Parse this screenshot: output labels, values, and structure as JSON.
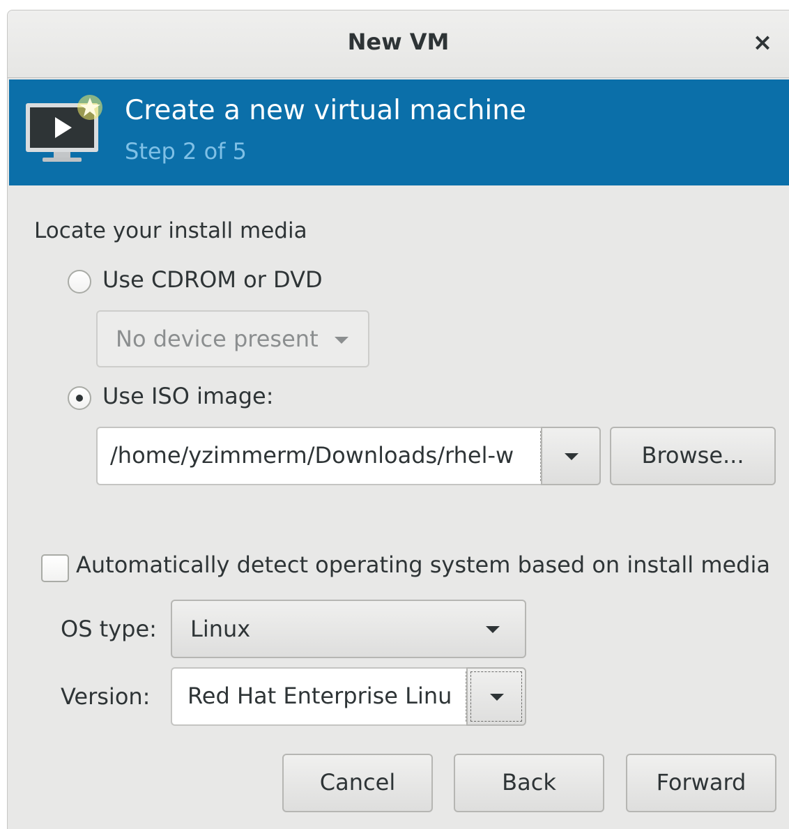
{
  "window": {
    "title": "New VM",
    "close_glyph": "×"
  },
  "banner": {
    "title": "Create a new virtual machine",
    "step": "Step 2 of 5",
    "icon": "vm-monitor-new-icon",
    "color": "#0b6fa9"
  },
  "install_media": {
    "section_label": "Locate your install media",
    "cdrom_option": {
      "label": "Use CDROM or DVD",
      "selected": false
    },
    "cdrom_device": {
      "value": "No device present",
      "disabled": true
    },
    "iso_option": {
      "label": "Use ISO image:",
      "selected": true
    },
    "iso_path": {
      "value": "/home/yzimmerm/Downloads/rhel-w"
    },
    "browse_label": "Browse..."
  },
  "os_detection": {
    "auto_detect": {
      "label": "Automatically detect operating system based on install media",
      "checked": false
    },
    "os_type": {
      "label": "OS type:",
      "value": "Linux"
    },
    "version": {
      "label": "Version:",
      "value": "Red Hat Enterprise Linu"
    }
  },
  "buttons": {
    "cancel": "Cancel",
    "back": "Back",
    "forward": "Forward"
  }
}
